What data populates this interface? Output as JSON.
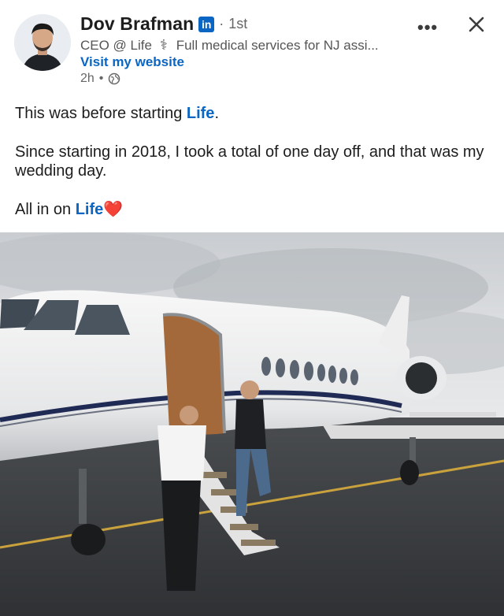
{
  "author": {
    "name": "Dov Brafman",
    "platform_badge": "in",
    "connection_degree": "1st",
    "headline_prefix": "CEO @ Life",
    "headline_suffix": "Full medical services for NJ assi...",
    "website_link": "Visit my website",
    "post_age": "2h",
    "visibility_icon": "globe-icon"
  },
  "actions": {
    "more_label": "•••",
    "close_icon": "close-icon"
  },
  "post": {
    "line1_before": "This was before starting ",
    "line1_mention": "Life",
    "line1_after": ".",
    "paragraph2": "Since starting in 2018, I took a total of one day off, and that was my wedding day.",
    "line3_before": "All in on ",
    "line3_mention": "Life",
    "line3_emoji": "❤️"
  },
  "colors": {
    "link_blue": "#0a66c2",
    "text": "#1d1d1d",
    "secondary_text": "#666666"
  }
}
